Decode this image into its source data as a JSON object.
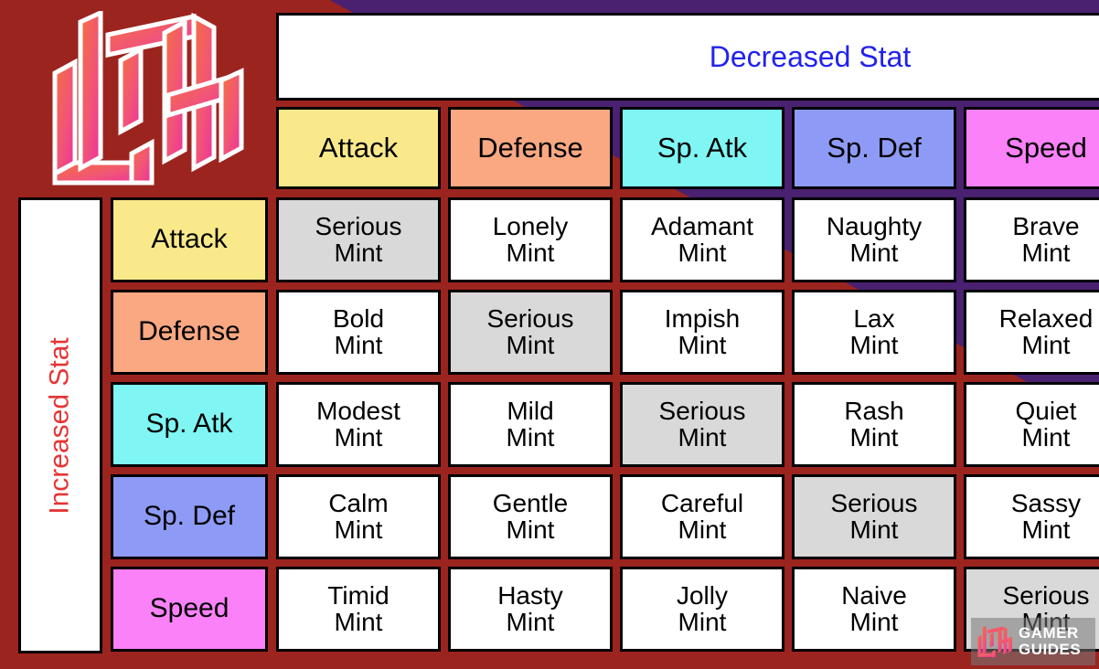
{
  "banner": {
    "decreased_stat_label": "Decreased Stat",
    "decreased_stat_color": "#2222ee"
  },
  "rail": {
    "increased_stat_label": "Increased Stat",
    "increased_stat_color": "#e53535"
  },
  "stats": [
    {
      "label": "Attack",
      "color": "#f9e98b"
    },
    {
      "label": "Defense",
      "color": "#f9a882"
    },
    {
      "label": "Sp. Atk",
      "color": "#7ff6f4"
    },
    {
      "label": "Sp. Def",
      "color": "#8e9bf6"
    },
    {
      "label": "Speed",
      "color": "#fb81f8"
    }
  ],
  "columns": [
    {
      "label": "Attack",
      "color": "#f9e98b"
    },
    {
      "label": "Defense",
      "color": "#f9a882"
    },
    {
      "label": "Sp. Atk",
      "color": "#7ff6f4"
    },
    {
      "label": "Sp. Def",
      "color": "#8e9bf6"
    },
    {
      "label": "Speed",
      "color": "#fb81f8"
    }
  ],
  "rows": [
    {
      "label": "Attack",
      "color": "#f9e98b"
    },
    {
      "label": "Defense",
      "color": "#f9a882"
    },
    {
      "label": "Sp. Atk",
      "color": "#7ff6f4"
    },
    {
      "label": "Sp. Def",
      "color": "#8e9bf6"
    },
    {
      "label": "Speed",
      "color": "#fb81f8"
    }
  ],
  "mint_word": "Mint",
  "neutral_cell_color": "#d9d9d9",
  "cells": [
    [
      {
        "nature": "Serious",
        "mint": "Mint",
        "neutral": true
      },
      {
        "nature": "Lonely",
        "mint": "Mint",
        "neutral": false
      },
      {
        "nature": "Adamant",
        "mint": "Mint",
        "neutral": false
      },
      {
        "nature": "Naughty",
        "mint": "Mint",
        "neutral": false
      },
      {
        "nature": "Brave",
        "mint": "Mint",
        "neutral": false
      }
    ],
    [
      {
        "nature": "Bold",
        "mint": "Mint",
        "neutral": false
      },
      {
        "nature": "Serious",
        "mint": "Mint",
        "neutral": true
      },
      {
        "nature": "Impish",
        "mint": "Mint",
        "neutral": false
      },
      {
        "nature": "Lax",
        "mint": "Mint",
        "neutral": false
      },
      {
        "nature": "Relaxed",
        "mint": "Mint",
        "neutral": false
      }
    ],
    [
      {
        "nature": "Modest",
        "mint": "Mint",
        "neutral": false
      },
      {
        "nature": "Mild",
        "mint": "Mint",
        "neutral": false
      },
      {
        "nature": "Serious",
        "mint": "Mint",
        "neutral": true
      },
      {
        "nature": "Rash",
        "mint": "Mint",
        "neutral": false
      },
      {
        "nature": "Quiet",
        "mint": "Mint",
        "neutral": false
      }
    ],
    [
      {
        "nature": "Calm",
        "mint": "Mint",
        "neutral": false
      },
      {
        "nature": "Gentle",
        "mint": "Mint",
        "neutral": false
      },
      {
        "nature": "Careful",
        "mint": "Mint",
        "neutral": false
      },
      {
        "nature": "Serious",
        "mint": "Mint",
        "neutral": true
      },
      {
        "nature": "Sassy",
        "mint": "Mint",
        "neutral": false
      }
    ],
    [
      {
        "nature": "Timid",
        "mint": "Mint",
        "neutral": false
      },
      {
        "nature": "Hasty",
        "mint": "Mint",
        "neutral": false
      },
      {
        "nature": "Jolly",
        "mint": "Mint",
        "neutral": false
      },
      {
        "nature": "Naive",
        "mint": "Mint",
        "neutral": false
      },
      {
        "nature": "Serious",
        "mint": "Mint",
        "neutral": true
      }
    ]
  ],
  "watermark": {
    "line1": "GAMER",
    "line2": "GUIDES"
  },
  "theme": {
    "background_purple": "#4a2170",
    "background_red": "#9c241f",
    "logo_gradient_start": "#f4703f",
    "logo_gradient_end": "#ee3a9b"
  }
}
